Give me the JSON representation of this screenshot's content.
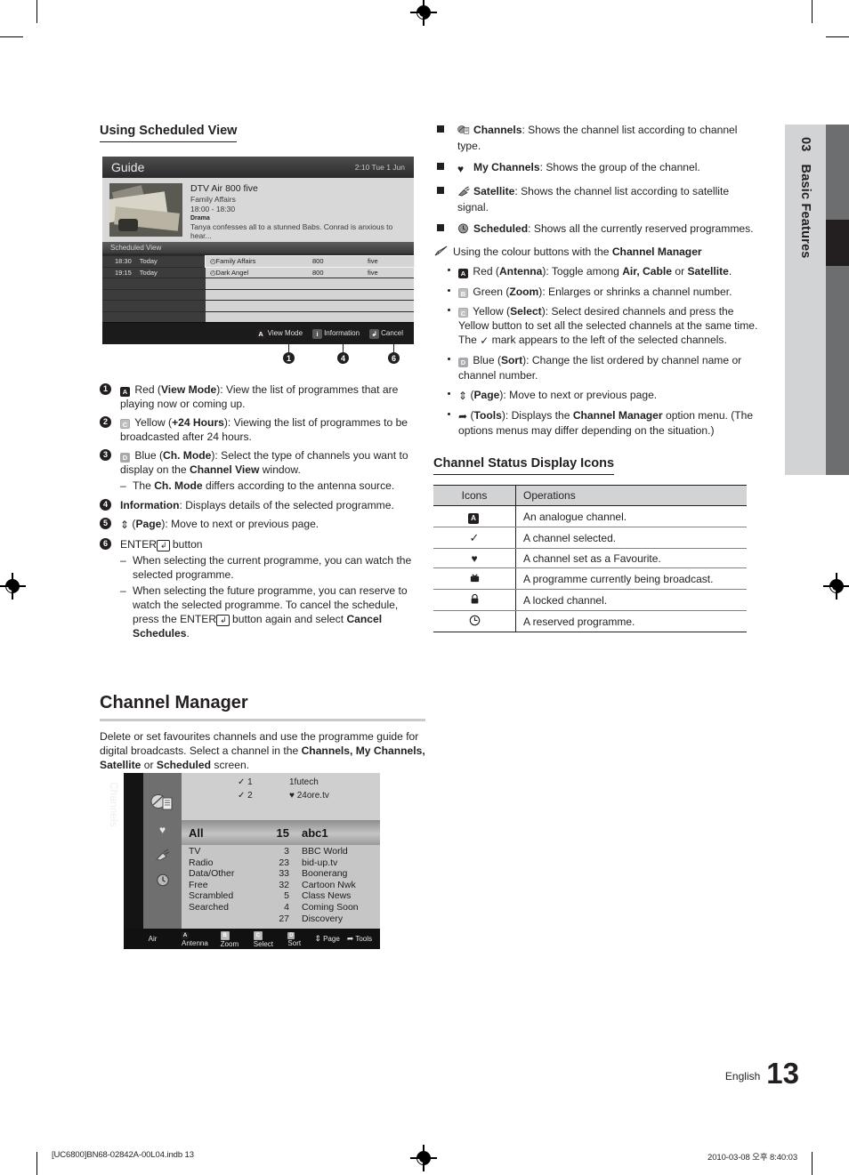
{
  "page": {
    "number": "13",
    "language": "English",
    "chapter_number": "03",
    "chapter_title": "Basic Features",
    "footer_left": "[UC6800]BN68-02842A-00L04.indb   13",
    "footer_right": "2010-03-08   오후 8:40:03"
  },
  "left_column": {
    "heading": "Using Scheduled View",
    "guide_screen": {
      "title": "Guide",
      "clock": "2:10 Tue 1 Jun",
      "info": {
        "channel": "DTV Air 800 five",
        "programme": "Family Affairs",
        "time": "18:00 - 18:30",
        "genre": "Drama",
        "synopsis": "Tanya confesses all to a stunned Babs. Conrad is anxious to hear..."
      },
      "section_label": "Scheduled View",
      "rows": [
        {
          "time": "18:30",
          "day": "Today",
          "name": "Family Affairs",
          "number": "800",
          "channel": "five"
        },
        {
          "time": "19:15",
          "day": "Today",
          "name": "Dark Angel",
          "number": "800",
          "channel": "five"
        },
        {
          "time": "",
          "day": "",
          "name": "",
          "number": "",
          "channel": ""
        },
        {
          "time": "",
          "day": "",
          "name": "",
          "number": "",
          "channel": ""
        },
        {
          "time": "",
          "day": "",
          "name": "",
          "number": "",
          "channel": ""
        },
        {
          "time": "",
          "day": "",
          "name": "",
          "number": "",
          "channel": ""
        }
      ],
      "footer_keys": [
        {
          "key": "A",
          "label": "View Mode"
        },
        {
          "key": "i",
          "label": "Information"
        },
        {
          "key": "↲",
          "label": "Cancel"
        }
      ]
    },
    "callouts": [
      "1",
      "4",
      "6"
    ],
    "numbered_items": [
      {
        "num": "1",
        "key": "A",
        "key_style": "a",
        "text_html": "Red (<b>View Mode</b>): View the list of programmes that are playing now or coming up."
      },
      {
        "num": "2",
        "key": "C",
        "key_style": "c",
        "text_html": "Yellow (<b>+24 Hours</b>): Viewing the list of programmes to be broadcasted after 24 hours."
      },
      {
        "num": "3",
        "key": "D",
        "key_style": "d",
        "text_html": "Blue (<b>Ch. Mode</b>): Select the type of channels you want to display on the <b>Channel View</b> window.",
        "sub": "The <b>Ch. Mode</b> differs according to the antenna source."
      },
      {
        "num": "4",
        "key": "",
        "key_style": "",
        "text_html": "<b>Information</b>: Displays details of the selected programme."
      },
      {
        "num": "5",
        "key": "",
        "key_style": "",
        "text_html": "<span class=\"glyph\">⇕</span> (<b>Page</b>): Move to next or previous page."
      },
      {
        "num": "6",
        "key": "",
        "key_style": "",
        "text_html": "ENTER<span class=\"enterk\">↲</span> button",
        "subs": [
          "When selecting the current programme, you can watch the selected programme.",
          "When selecting the future programme, you can reserve to watch the selected programme. To cancel the schedule, press the ENTER<span class=\"enterk\">↲</span> button again and select <b>Cancel Schedules</b>."
        ]
      }
    ],
    "channel_manager": {
      "heading": "Channel Manager",
      "intro_html": "Delete or set favourites channels and use the programme guide for digital broadcasts. Select a channel in the <b>Channels, My Channels, Satellite</b> or <b>Scheduled</b> screen.",
      "screen": {
        "side_label": "Channels",
        "header_rows": [
          {
            "check": "✓",
            "num": "1",
            "name": "1futech",
            "fav": ""
          },
          {
            "check": "✓",
            "num": "2",
            "name": "24ore.tv",
            "fav": "♥"
          }
        ],
        "selected": {
          "label": "All",
          "num": "15",
          "name": "abc1"
        },
        "categories": [
          "TV",
          "Radio",
          "Data/Other",
          "Free",
          "Scrambled",
          "Searched"
        ],
        "numbers": [
          "3",
          "23",
          "33",
          "32",
          "5",
          "4",
          "27"
        ],
        "channels": [
          "BBC World",
          "bid-up.tv",
          "Boonerang",
          "Cartoon Nwk",
          "Class News",
          "Coming Soon",
          "Discovery"
        ],
        "footer_source": "Air",
        "footer_keys": [
          {
            "key": "A",
            "style": "a",
            "label": "Antenna"
          },
          {
            "key": "B",
            "style": "b",
            "label": "Zoom"
          },
          {
            "key": "C",
            "style": "c",
            "label": "Select"
          },
          {
            "key": "D",
            "style": "d",
            "label": "Sort"
          },
          {
            "key": "⇕",
            "style": "plain",
            "label": "Page"
          },
          {
            "key": "➦",
            "style": "plain",
            "label": "Tools"
          }
        ]
      }
    }
  },
  "right_column": {
    "modes": [
      {
        "icon": "channels-icon",
        "text_html": "<b>Channels</b>: Shows the channel list according to channel type."
      },
      {
        "icon": "heart-icon",
        "text_html": "<b>My Channels</b>: Shows the group of the channel."
      },
      {
        "icon": "satellite-icon",
        "text_html": "<b>Satellite</b>: Shows the channel list according to satellite signal."
      },
      {
        "icon": "clock-icon",
        "text_html": "<b>Scheduled</b>: Shows all the currently reserved programmes."
      }
    ],
    "note_html": "Using the colour buttons with the <b>Channel Manager</b>",
    "colour_buttons": [
      {
        "key": "A",
        "style": "a",
        "text_html": "Red (<b>Antenna</b>): Toggle among <b>Air, Cable</b> or <b>Satellite</b>."
      },
      {
        "key": "B",
        "style": "b",
        "text_html": "Green (<b>Zoom</b>): Enlarges or shrinks a channel number."
      },
      {
        "key": "C",
        "style": "c",
        "text_html": "Yellow (<b>Select</b>): Select desired channels and press the Yellow button to set all the selected channels at the same time. The <span class=\"glyph\">✓</span> mark appears to the left of the selected channels."
      },
      {
        "key": "D",
        "style": "d",
        "text_html": "Blue (<b>Sort</b>): Change the list ordered by channel name or channel number."
      },
      {
        "key": "⇕",
        "style": "plain",
        "text_html": "(<b>Page</b>): Move to next or previous page."
      },
      {
        "key": "➦",
        "style": "plain",
        "text_html": "(<b>Tools</b>): Displays the <b>Channel Manager</b> option menu. (The options menus may differ depending on the situation.)"
      }
    ],
    "table": {
      "heading": "Channel Status Display Icons",
      "columns": [
        "Icons",
        "Operations"
      ],
      "rows": [
        {
          "icon": "A",
          "icon_kind": "analogue",
          "operation": "An analogue channel."
        },
        {
          "icon": "✓",
          "icon_kind": "check",
          "operation": "A channel selected."
        },
        {
          "icon": "♥",
          "icon_kind": "heart",
          "operation": "A channel set as a Favourite."
        },
        {
          "icon": "ṯ",
          "icon_kind": "tv",
          "operation": "A programme currently being broadcast."
        },
        {
          "icon": "ὑ2",
          "icon_kind": "lock",
          "operation": "A locked channel."
        },
        {
          "icon": "ὕ0",
          "icon_kind": "clock",
          "operation": "A reserved programme."
        }
      ]
    }
  }
}
